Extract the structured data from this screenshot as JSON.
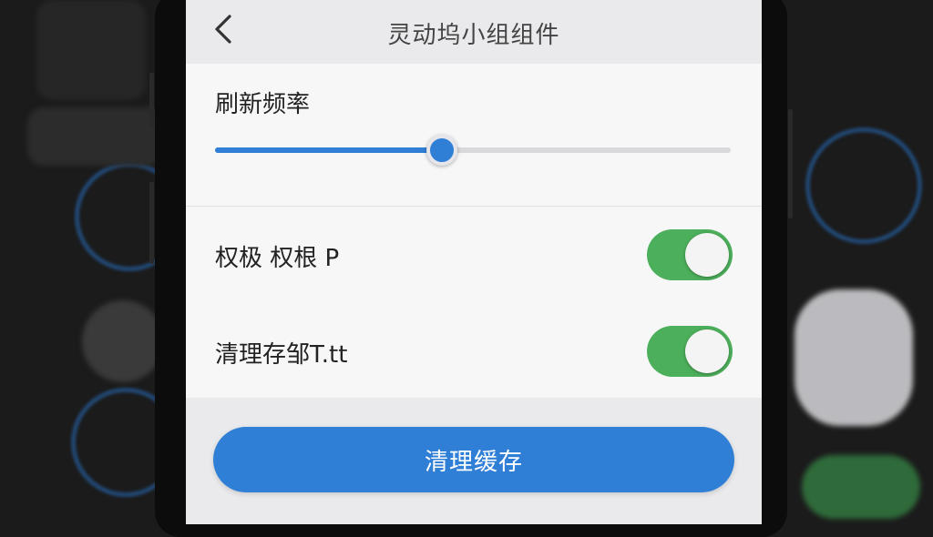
{
  "header": {
    "title": "灵动坞小组组件",
    "back_icon": "chevron-left-icon"
  },
  "refresh_rate": {
    "label": "刷新频率",
    "value_fraction": 0.44
  },
  "settings": [
    {
      "label": "权极 权根 P",
      "enabled": true
    },
    {
      "label": "清理存邹T.tt",
      "enabled": true
    }
  ],
  "action_button": {
    "label": "清理缓存"
  },
  "colors": {
    "accent": "#2f7fd6",
    "toggle_on": "#4caf5b",
    "screen_bg": "#f2f2f4",
    "frame": "#0c0c0c"
  }
}
